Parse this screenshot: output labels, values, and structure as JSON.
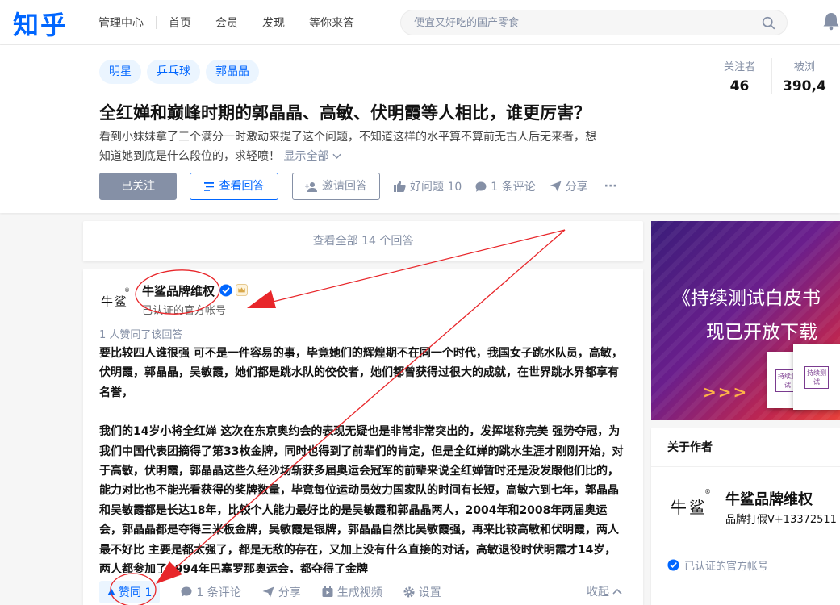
{
  "nav": {
    "logo": "知乎",
    "items": [
      "管理中心",
      "首页",
      "会员",
      "发现",
      "等你来答"
    ],
    "search_placeholder": "便宜又好吃的国产零食"
  },
  "question": {
    "tags": [
      "明星",
      "乒乓球",
      "郭晶晶"
    ],
    "title": "全红婵和巅峰时期的郭晶晶、高敏、伏明霞等人相比，谁更厉害？",
    "desc_line1": "看到小妹妹拿了三个满分一时激动来提了这个问题，不知道这样的水平算不算前无古人后无来者，想",
    "desc_line2": "知道她到底是什么段位的，求轻喷！",
    "show_all": "显示全部",
    "followed_label": "已关注",
    "view_answers_label": "查看回答",
    "invite_label": "邀请回答",
    "good_question_label": "好问题 10",
    "comments_label": "1 条评论",
    "share_label": "分享",
    "more_label": "···",
    "followers_label": "关注者",
    "followers_value": "46",
    "views_label": "被浏",
    "views_value": "390,4"
  },
  "view_all": "查看全部 14 个回答",
  "answer": {
    "avatar_text": "牛鲨",
    "reg_mark": "®",
    "author_name": "牛鲨品牌维权",
    "author_sub": "已认证的官方帐号",
    "voters": "1 人赞同了该回答",
    "para1": "要比较四人谁很强 可不是一件容易的事，毕竟她们的辉煌期不在同一个时代，我国女子跳水队员，高敏，伏明霞，郭晶晶，吴敏霞，她们都是跳水队的佼佼者，她们都曾获得过很大的成就，在世界跳水界都享有名誉，",
    "para2": "我们的14岁小将全红婵 这次在东京奥约会的表现无疑也是非常非常突出的，发挥堪称完美 强势夺冠，为我们中国代表团摘得了第33枚金牌，同时也得到了前辈们的肯定，但是全红婵的跳水生涯才刚刚开始，对于高敏，伏明霞，郭晶晶这些久经沙场斩获多届奥运会冠军的前辈来说全红婵暂时还是没发跟他们比的，能力对比也不能光看获得的奖牌数量，毕竟每位运动员效力国家队的时间有长短，高敏六到七年，郭晶晶和吴敏霞都是长达18年，比较个人能力最好比的是吴敏霞和郭晶晶两人，2004年和2008年两届奥运会，郭晶晶都是夺得三米板金牌，吴敏霞是银牌，郭晶晶自然比吴敏霞强，再来比较高敏和伏明霞，两人最不好比 主要是都太强了，都是无敌的存在，又加上没有什么直接的对话，高敏退役时伏明霞才14岁，两人都参加了1994年巴塞罗那奥运会，都夺得了金牌",
    "vote_label": "赞同 1",
    "comment_label": "1 条评论",
    "share_label": "分享",
    "video_label": "生成视频",
    "settings_label": "设置",
    "collapse_label": "收起"
  },
  "banner": {
    "line1": "《持续测试白皮书",
    "line2": "现已开放下载",
    "arrows": ">>>",
    "book_title": "持续测试"
  },
  "about": {
    "title": "关于作者",
    "avatar_text": "牛鲨",
    "reg_mark": "®",
    "name": "牛鲨品牌维权",
    "desc": "品牌打假V+13372511",
    "verified": "已认证的官方帐号"
  },
  "colors": {
    "brand": "#0066ff",
    "muted": "#8590a6",
    "annotation": "#e8262a"
  }
}
